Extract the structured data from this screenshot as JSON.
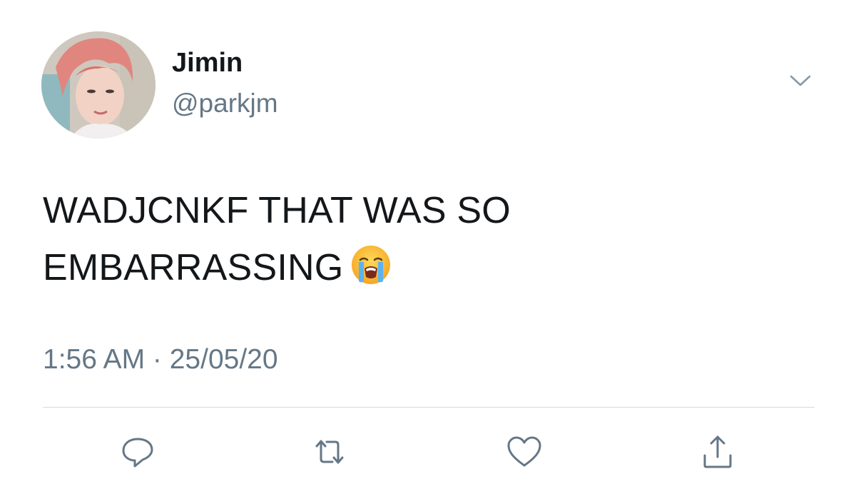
{
  "tweet": {
    "author": {
      "display_name": "Jimin",
      "handle": "@parkjm"
    },
    "text_line1": "WADJCNKF THAT WAS SO",
    "text_line2": "EMBARRASSING",
    "emoji": "loudly-crying-face",
    "timestamp": "1:56 AM · 25/05/20"
  },
  "actions": [
    {
      "name": "reply",
      "icon": "reply-icon"
    },
    {
      "name": "retweet",
      "icon": "retweet-icon"
    },
    {
      "name": "like",
      "icon": "heart-icon"
    },
    {
      "name": "share",
      "icon": "share-icon"
    }
  ],
  "colors": {
    "text": "#14171a",
    "secondary": "#657786",
    "divider": "#d6dbdf",
    "icon": "#657786"
  }
}
